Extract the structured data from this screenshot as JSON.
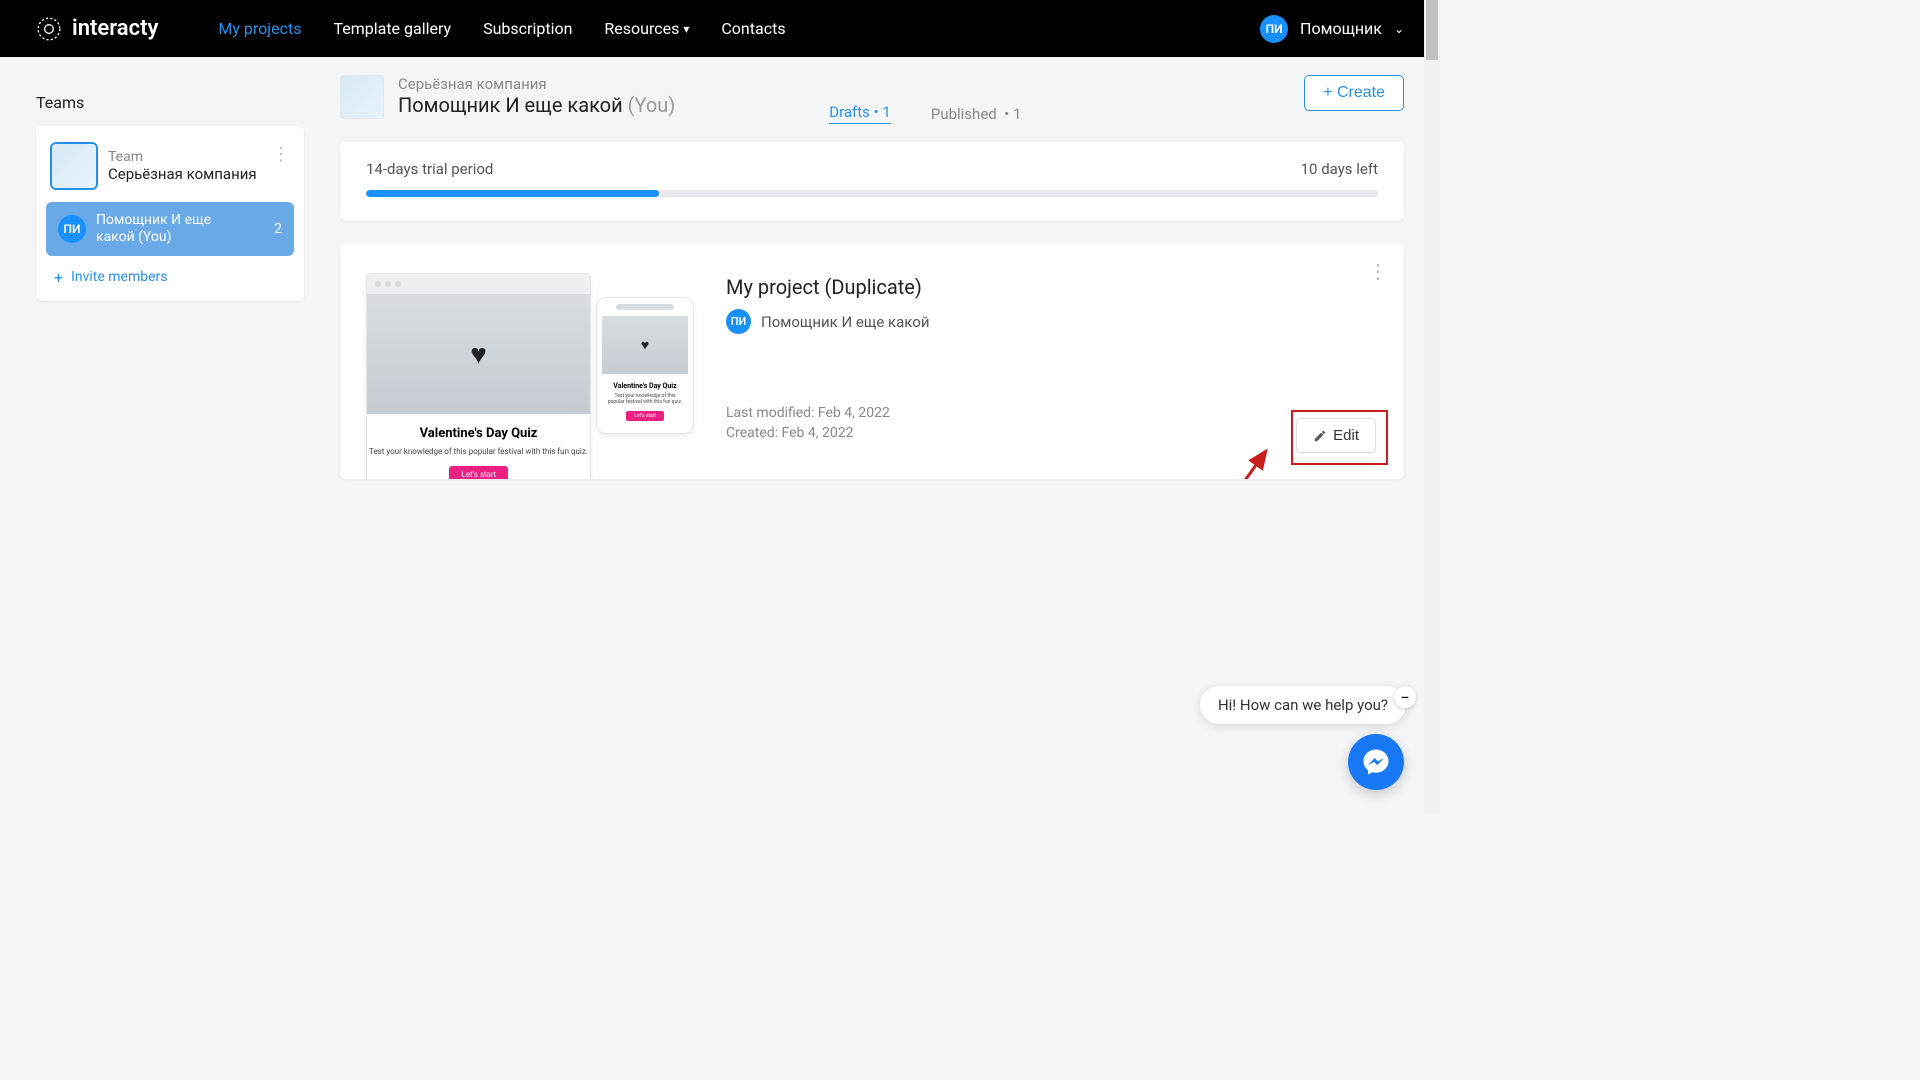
{
  "header": {
    "brand": "interacty",
    "nav": {
      "my_projects": "My projects",
      "template_gallery": "Template gallery",
      "subscription": "Subscription",
      "resources": "Resources",
      "contacts": "Contacts"
    },
    "user_initials": "ПИ",
    "user_name": "Помощник"
  },
  "sidebar": {
    "title": "Teams",
    "team_label": "Team",
    "team_name": "Серьёзная компания",
    "member_initials": "ПИ",
    "member_line1": "Помощник И еще",
    "member_line2": "какой (You)",
    "member_count": "2",
    "invite": "Invite members"
  },
  "topbar": {
    "company": "Серьёзная компания",
    "owner_name": "Помощник И еще какой",
    "owner_you": "(You)",
    "drafts_label": "Drafts",
    "drafts_count": "1",
    "published_label": "Published",
    "published_count": "1",
    "create": "+ Create"
  },
  "trial": {
    "label": "14-days trial period",
    "remaining": "10 days left"
  },
  "project": {
    "title": "My project (Duplicate)",
    "owner_initials": "ПИ",
    "owner_name": "Помощник И еще какой",
    "modified": "Last modified: Feb 4, 2022",
    "created": "Created: Feb 4, 2022",
    "edit": "Edit",
    "preview": {
      "title": "Valentine's Day Quiz",
      "sub_desktop": "Test your knowledge of this popular festival with this fun quiz.",
      "sub_mobile": "Test your knowledge of this popular festival with this fun quiz.",
      "cta": "Let's start"
    }
  },
  "chat": {
    "greeting": "Hi! How can we help you?"
  }
}
